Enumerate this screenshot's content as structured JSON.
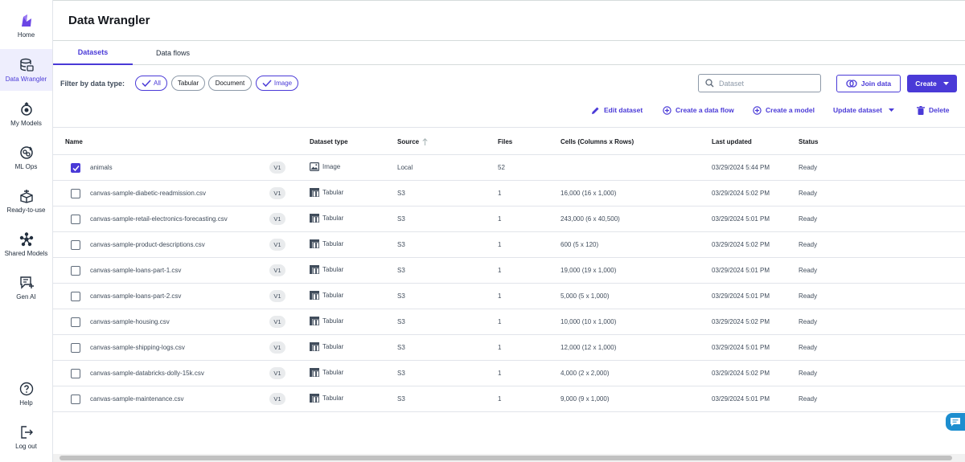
{
  "app": {
    "title": "Data Wrangler"
  },
  "sidebar": {
    "items": [
      {
        "label": "Home",
        "icon": "home-logo-icon"
      },
      {
        "label": "Data Wrangler",
        "icon": "data-wrangler-icon",
        "active": true
      },
      {
        "label": "My Models",
        "icon": "my-models-icon"
      },
      {
        "label": "ML Ops",
        "icon": "ml-ops-icon"
      },
      {
        "label": "Ready-to-use",
        "icon": "ready-to-use-icon"
      },
      {
        "label": "Shared Models",
        "icon": "shared-models-icon"
      },
      {
        "label": "Gen AI",
        "icon": "gen-ai-icon"
      },
      {
        "label": "Help",
        "icon": "help-icon"
      },
      {
        "label": "Log out",
        "icon": "logout-icon"
      }
    ]
  },
  "tabs": [
    {
      "label": "Datasets",
      "active": true
    },
    {
      "label": "Data flows",
      "active": false
    }
  ],
  "filter": {
    "label": "Filter by data type:",
    "chips": [
      {
        "label": "All",
        "selected": true
      },
      {
        "label": "Tabular",
        "selected": false
      },
      {
        "label": "Document",
        "selected": false
      },
      {
        "label": "Image",
        "selected": true
      }
    ]
  },
  "search": {
    "placeholder": "Dataset",
    "value": ""
  },
  "buttons": {
    "join": "Join data",
    "create": "Create"
  },
  "actions": {
    "edit": "Edit dataset",
    "create_flow": "Create a data flow",
    "create_model": "Create a model",
    "update": "Update dataset",
    "delete": "Delete"
  },
  "table": {
    "columns": {
      "name": "Name",
      "type": "Dataset type",
      "source": "Source",
      "files": "Files",
      "cells": "Cells (Columns x Rows)",
      "updated": "Last updated",
      "status": "Status"
    },
    "rows": [
      {
        "checked": true,
        "name": "animals",
        "version": "V1",
        "type": "Image",
        "source": "Local",
        "files": "52",
        "cells": "",
        "updated": "03/29/2024 5:44 PM",
        "status": "Ready"
      },
      {
        "checked": false,
        "name": "canvas-sample-diabetic-readmission.csv",
        "version": "V1",
        "type": "Tabular",
        "source": "S3",
        "files": "1",
        "cells": "16,000 (16 x 1,000)",
        "updated": "03/29/2024 5:02 PM",
        "status": "Ready"
      },
      {
        "checked": false,
        "name": "canvas-sample-retail-electronics-forecasting.csv",
        "version": "V1",
        "type": "Tabular",
        "source": "S3",
        "files": "1",
        "cells": "243,000 (6 x 40,500)",
        "updated": "03/29/2024 5:01 PM",
        "status": "Ready"
      },
      {
        "checked": false,
        "name": "canvas-sample-product-descriptions.csv",
        "version": "V1",
        "type": "Tabular",
        "source": "S3",
        "files": "1",
        "cells": "600 (5 x 120)",
        "updated": "03/29/2024 5:02 PM",
        "status": "Ready"
      },
      {
        "checked": false,
        "name": "canvas-sample-loans-part-1.csv",
        "version": "V1",
        "type": "Tabular",
        "source": "S3",
        "files": "1",
        "cells": "19,000 (19 x 1,000)",
        "updated": "03/29/2024 5:01 PM",
        "status": "Ready"
      },
      {
        "checked": false,
        "name": "canvas-sample-loans-part-2.csv",
        "version": "V1",
        "type": "Tabular",
        "source": "S3",
        "files": "1",
        "cells": "5,000 (5 x 1,000)",
        "updated": "03/29/2024 5:01 PM",
        "status": "Ready"
      },
      {
        "checked": false,
        "name": "canvas-sample-housing.csv",
        "version": "V1",
        "type": "Tabular",
        "source": "S3",
        "files": "1",
        "cells": "10,000 (10 x 1,000)",
        "updated": "03/29/2024 5:02 PM",
        "status": "Ready"
      },
      {
        "checked": false,
        "name": "canvas-sample-shipping-logs.csv",
        "version": "V1",
        "type": "Tabular",
        "source": "S3",
        "files": "1",
        "cells": "12,000 (12 x 1,000)",
        "updated": "03/29/2024 5:01 PM",
        "status": "Ready"
      },
      {
        "checked": false,
        "name": "canvas-sample-databricks-dolly-15k.csv",
        "version": "V1",
        "type": "Tabular",
        "source": "S3",
        "files": "1",
        "cells": "4,000 (2 x 2,000)",
        "updated": "03/29/2024 5:02 PM",
        "status": "Ready"
      },
      {
        "checked": false,
        "name": "canvas-sample-maintenance.csv",
        "version": "V1",
        "type": "Tabular",
        "source": "S3",
        "files": "1",
        "cells": "9,000 (9 x 1,000)",
        "updated": "03/29/2024 5:01 PM",
        "status": "Ready"
      }
    ]
  },
  "colors": {
    "accent": "#4a3ad7",
    "active_bg": "#eeeefd",
    "chat": "#1d8ecf"
  }
}
